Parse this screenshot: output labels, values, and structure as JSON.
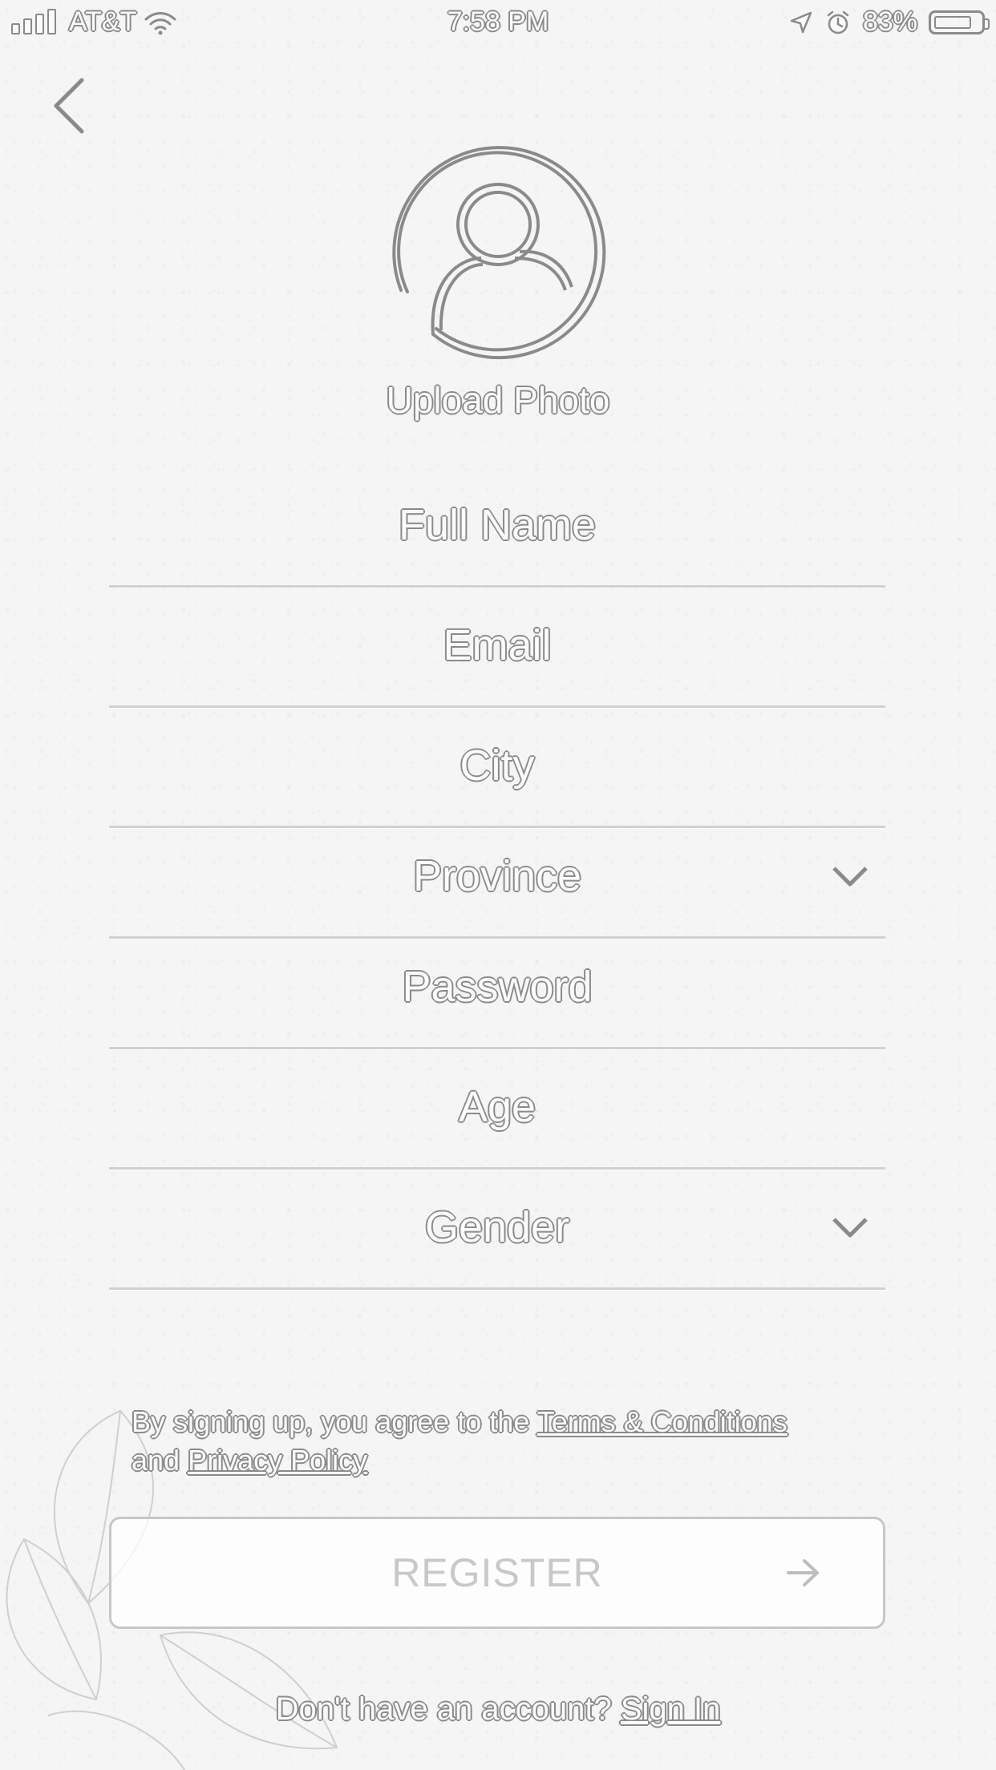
{
  "status_bar": {
    "carrier": "AT&T",
    "time": "7:58 PM",
    "battery_percent": "83%",
    "battery_level": 0.83
  },
  "header": {
    "back_icon": "chevron-left-icon"
  },
  "avatar": {
    "icon": "user-circle-icon",
    "upload_label": "Upload Photo"
  },
  "form": {
    "full_name_placeholder": "Full Name",
    "email_placeholder": "Email",
    "city_placeholder": "City",
    "province_placeholder": "Province",
    "password_placeholder": "Password",
    "age_placeholder": "Age",
    "gender_placeholder": "Gender"
  },
  "terms": {
    "prefix": "By signing up, you agree to the ",
    "terms_link": "Terms & Conditions",
    "middle": "and ",
    "privacy_link": "Privacy Policy"
  },
  "register": {
    "label": "REGISTER",
    "icon": "arrow-right-icon"
  },
  "footer": {
    "question": "Don't have an account? ",
    "signin_link": "Sign In"
  },
  "colors": {
    "background": "#f5f5f5",
    "outline": "#8a8a8a",
    "divider": "#d0d0d0",
    "button_text": "#c8c8c8"
  }
}
